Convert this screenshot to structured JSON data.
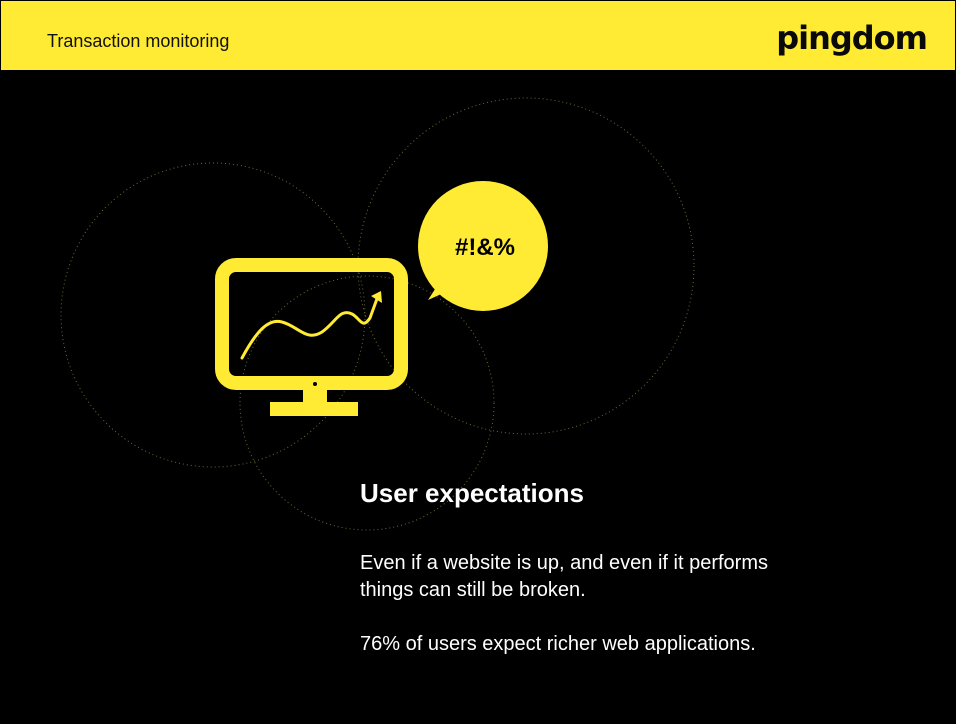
{
  "header": {
    "title": "Transaction monitoring",
    "logo": "pingdom"
  },
  "illustration": {
    "speech_bubble_text": "#!&%",
    "icon": "monitor-chart-icon"
  },
  "content": {
    "heading": "User expectations",
    "paragraph_1_line_1": "Even if a website is up, and even if it performs",
    "paragraph_1_line_2": "things can still be broken.",
    "paragraph_2": "76% of users expect richer web applications."
  },
  "colors": {
    "accent": "#FFEB33",
    "background": "#000000",
    "text": "#FFFFFF"
  }
}
